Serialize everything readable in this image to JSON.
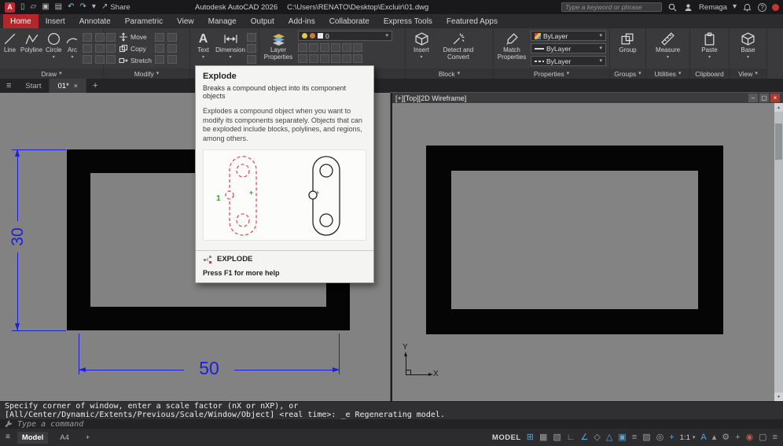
{
  "icons": {
    "caret": "▾",
    "close": "×",
    "minimize": "–",
    "restore": "▢",
    "hamburger": "≡",
    "plus": "+",
    "scroll_up": "▴",
    "scroll_down": "▾",
    "new": "▯",
    "open": "▱",
    "save": "▣",
    "plot": "▤",
    "undo": "↶",
    "redo": "↷",
    "share_arrow": "↗",
    "help": "?",
    "text_glyph": "A"
  },
  "titlebar": {
    "logo": "A",
    "share": "Share",
    "app_title": "Autodesk AutoCAD 2026",
    "file_path": "C:\\Users\\RENATO\\Desktop\\Excluir\\01.dwg",
    "search_placeholder": "Type a keyword or phrase",
    "account": "Remaga"
  },
  "tabs": [
    "Home",
    "Insert",
    "Annotate",
    "Parametric",
    "View",
    "Manage",
    "Output",
    "Add-ins",
    "Collaborate",
    "Express Tools",
    "Featured Apps"
  ],
  "ribbon": {
    "panels": {
      "draw": "Draw",
      "modify": "Modify",
      "block": "Block",
      "properties": "Properties",
      "groups": "Groups",
      "utilities": "Utilities",
      "clipboard": "Clipboard",
      "view": "View"
    },
    "tools": {
      "line": "Line",
      "polyline": "Polyline",
      "circle": "Circle",
      "arc": "Arc",
      "move": "Move",
      "copy": "Copy",
      "stretch": "Stretch",
      "text": "Text",
      "dimension": "Dimension",
      "layer_props": "Layer Properties",
      "insert": "Insert",
      "detect": "Detect and Convert",
      "match": "Match Properties",
      "group": "Group",
      "measure": "Measure",
      "paste": "Paste",
      "base": "Base"
    },
    "layer_value": "0",
    "bylayer": "ByLayer"
  },
  "tooltip": {
    "title": "Explode",
    "subtitle": "Breaks a compound object into its component objects",
    "body": "Explodes a compound object when you want to modify its components separately. Objects that can be exploded include blocks, polylines, and regions, among others.",
    "marker": "1",
    "command": "EXPLODE",
    "help": "Press F1 for more help"
  },
  "file_tabs": {
    "start": "Start",
    "doc": "01*"
  },
  "viewport": {
    "label": "[+][Top][2D Wireframe]",
    "dim_v": "30",
    "dim_h": "50",
    "axis_x": "X",
    "axis_y": "Y"
  },
  "command_line": {
    "line1": "Specify corner of window, enter a scale factor (nX or nXP), or",
    "line2": "[All/Center/Dynamic/Extents/Previous/Scale/Window/Object] <real time>: _e Regenerating model.",
    "prompt": "Type a command"
  },
  "status_bar": {
    "model": "Model",
    "layout": "A4",
    "space_label": "MODEL",
    "scale": "1:1",
    "icons_left": [
      {
        "name": "grid-icon",
        "glyph": "⊞",
        "color": "#52a8e2"
      },
      {
        "name": "snap-icon",
        "glyph": "▦",
        "color": "#9d9d9d"
      },
      {
        "name": "infer-icon",
        "glyph": "▧",
        "color": "#9d9d9d"
      },
      {
        "name": "ortho-icon",
        "glyph": "∟",
        "color": "#9d9d9d"
      },
      {
        "name": "polar-icon",
        "glyph": "∠",
        "color": "#52a8e2"
      },
      {
        "name": "isodraft-icon",
        "glyph": "◇",
        "color": "#9d9d9d"
      },
      {
        "name": "otrack-icon",
        "glyph": "△",
        "color": "#52a8e2"
      },
      {
        "name": "osnap-icon",
        "glyph": "▣",
        "color": "#52a8e2"
      },
      {
        "name": "lineweight-icon",
        "glyph": "≡",
        "color": "#9d9d9d"
      },
      {
        "name": "transparency-icon",
        "glyph": "▨",
        "color": "#9d9d9d"
      },
      {
        "name": "selection-cycling-icon",
        "glyph": "◎",
        "color": "#9d9d9d"
      },
      {
        "name": "dynamic-input-icon",
        "glyph": "+",
        "color": "#52a8e2"
      }
    ],
    "icons_right": [
      {
        "name": "annotation-visibility-icon",
        "glyph": "A",
        "color": "#52a8e2"
      },
      {
        "name": "autoscale-icon",
        "glyph": "▴",
        "color": "#9d9d9d"
      },
      {
        "name": "workspace-gear-icon",
        "glyph": "⚙",
        "color": "#9d9d9d"
      },
      {
        "name": "annotation-monitor-icon",
        "glyph": "+",
        "color": "#9d9d9d"
      },
      {
        "name": "isolate-icon",
        "glyph": "◉",
        "color": "#c05a52"
      },
      {
        "name": "graphics-performance-icon",
        "glyph": "▢",
        "color": "#9d9d9d"
      },
      {
        "name": "customize-icon",
        "glyph": "≡",
        "color": "#9d9d9d"
      }
    ]
  }
}
